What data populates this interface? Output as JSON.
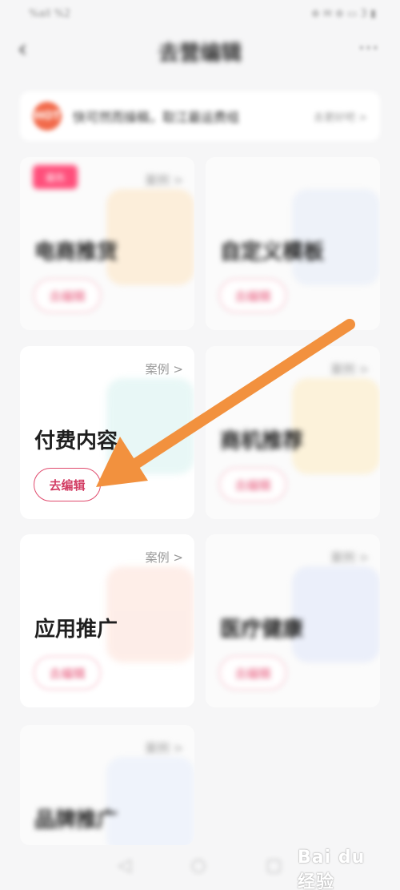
{
  "status_bar": {
    "left": "%all %2",
    "right": "⊕ ✉ ⊛ ▭ 3 ▮"
  },
  "header": {
    "back_icon": "back-arrow-icon",
    "title": "去营编辑",
    "more_label": "···"
  },
  "notice": {
    "icon_label": "HOT",
    "text": "快可然而操稿，取江最运费组",
    "link": "去更好吧 >"
  },
  "cards": [
    {
      "title": "电商推货",
      "tag": "最热",
      "case": "案例 >",
      "edit": "去编辑",
      "deco_color": "#fde3c0"
    },
    {
      "title": "自定义模板",
      "case": "",
      "edit": "去编辑",
      "deco_color": "#e4ebf7"
    },
    {
      "title": "付费内容",
      "case": "案例 >",
      "edit": "去编辑",
      "deco_color": "#d6f1ef"
    },
    {
      "title": "商机推荐",
      "case": "案例 >",
      "edit": "去编辑",
      "deco_color": "#fdebbf"
    },
    {
      "title": "应用推广",
      "case": "案例 >",
      "edit": "去编辑",
      "deco_color": "#fde0d6"
    },
    {
      "title": "医疗健康",
      "case": "案例 >",
      "edit": "去编辑",
      "deco_color": "#dfe6fa"
    },
    {
      "title": "品牌推广",
      "case": "案例 >",
      "edit": "",
      "deco_color": "#e6ecfb"
    }
  ],
  "bottom_nav": {
    "items": [
      "◁",
      "○",
      "▢"
    ]
  },
  "watermark": "Bai du 经验",
  "colors": {
    "accent": "#e04a6d",
    "arrow": "#f2913e",
    "notice_icon": "#f26a4b"
  }
}
